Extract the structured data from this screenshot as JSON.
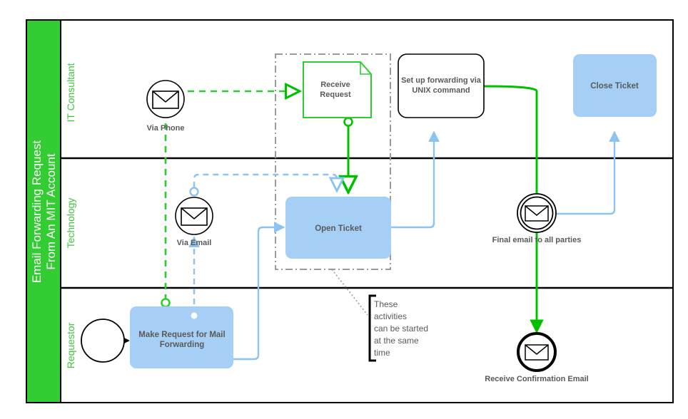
{
  "pool": {
    "title_line1": "Email Forwarding Request",
    "title_line2": "From An MIT Account",
    "band_color": "#33cc33"
  },
  "lanes": [
    {
      "id": "it-consultant",
      "label": "IT Consultant"
    },
    {
      "id": "technology",
      "label": "Technology"
    },
    {
      "id": "requestor",
      "label": "Requestor"
    }
  ],
  "colors": {
    "green": "#00c000",
    "green_bright": "#2fcc2f",
    "blue_fill": "#a5cff5",
    "blue_line": "#8dc3f2",
    "gray_group": "#9a9a9a",
    "text": "#5a5a5a",
    "black": "#000000"
  },
  "nodes": {
    "via_phone": {
      "label": "Via Phone",
      "icon": "envelope-icon"
    },
    "receive_request": {
      "label_line1": "Receive",
      "label_line2": "Request"
    },
    "set_up_forwarding": {
      "label_line1": "Set up forwarding via",
      "label_line2": "UNIX command"
    },
    "close_ticket": {
      "label": "Close Ticket"
    },
    "via_email": {
      "label": "Via Email",
      "icon": "envelope-icon"
    },
    "open_ticket": {
      "label": "Open Ticket"
    },
    "final_email": {
      "label": "Final email to all parties",
      "icon": "envelope-icon"
    },
    "start_event": {
      "label": ""
    },
    "make_request": {
      "label_line1": "Make Request for Mail",
      "label_line2": "Forwarding"
    },
    "receive_confirmation": {
      "label": "Receive Confirmation Email",
      "icon": "envelope-icon"
    }
  },
  "annotation": {
    "lines": [
      "These",
      "activities",
      "can be started",
      "at the same",
      "time"
    ],
    "line1": "These",
    "line2": "activities",
    "line3": "can be started",
    "line4": "at the same",
    "line5": "time"
  }
}
